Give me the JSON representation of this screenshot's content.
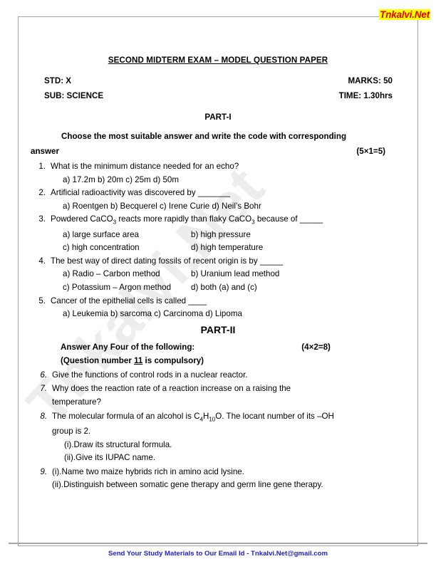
{
  "logo": {
    "text": "Tnkalvi.Net"
  },
  "watermark": {
    "text": "Tnkalvi.Net"
  },
  "header": {
    "title": "SECOND MIDTERM EXAM – MODEL QUESTION PAPER",
    "std_label": "STD: X",
    "marks_label": "MARKS: 50",
    "sub_label": "SUB:  SCIENCE",
    "time_label": "TIME: 1.30hrs"
  },
  "part1": {
    "heading": "PART-I",
    "instruction_line1": "Choose the most suitable answer and write the code with corresponding",
    "instruction_line2": "answer",
    "marks": "(5×1=5)",
    "questions": [
      {
        "number": "1.",
        "text": "What is the minimum distance needed for an echo?",
        "options_lines": [
          "a) 17.2m    b) 20m      c) 25m      d) 50m"
        ]
      },
      {
        "number": "2.",
        "text": "Artificial radioactivity was discovered by _______",
        "options_lines": [
          "a) Roentgen   b) Becquerel    c) Irene Curie    d) Neil’s Bohr"
        ]
      },
      {
        "number": "3.",
        "text_html": "Powdered CaCO<sub>3</sub> reacts more rapidly than flaky CaCO<sub>3</sub> because of _____",
        "options_2col": [
          {
            "left": "a) large surface area",
            "right": "b) high pressure"
          },
          {
            "left": "c) high concentration",
            "right": "d) high temperature"
          }
        ]
      },
      {
        "number": "4.",
        "text": "The best way of direct dating fossils of recent origin is by _____",
        "options_2col": [
          {
            "left": "a) Radio – Carbon method",
            "right": "b) Uranium lead method"
          },
          {
            "left": "c) Potassium – Argon method",
            "right": "d) both (a) and (c)"
          }
        ]
      },
      {
        "number": "5.",
        "text": "Cancer of  the epithelial cells is called ____",
        "options_lines": [
          "a) Leukemia   b) sarcoma  c) Carcinoma  d) Lipoma"
        ]
      }
    ]
  },
  "part2": {
    "heading": "PART-II",
    "instruction_line1": "Answer Any Four of the following:",
    "marks": "(4×2=8)",
    "instruction_line2_pre": "(Question number ",
    "instruction_line2_num": "11",
    "instruction_line2_post": " is compulsory)",
    "questions": [
      {
        "number": "6.",
        "text": "Give the functions of control rods in a nuclear reactor.",
        "extra_lines": []
      },
      {
        "number": "7.",
        "text": "Why does the reaction rate of a reaction increase on a raising the",
        "continuation": "temperature?",
        "extra_lines": []
      },
      {
        "number": "8.",
        "text_html": "The molecular formula of an alcohol is C<sub>4</sub>H<sub>10</sub>O. The locant number of its –OH",
        "continuation": "group is 2.",
        "extra_lines": [
          "(i).Draw its structural formula.",
          "(ii).Give its IUPAC name."
        ]
      },
      {
        "number": "9.",
        "text": "(i).Name two maize hybrids rich in amino acid lysine.",
        "extra_lines": [
          "(ii).Distinguish between somatic gene therapy and germ line gene therapy."
        ]
      }
    ]
  },
  "footer": {
    "text": "Send Your Study Materials to Our Email Id - Tnkalvi.Net@gmail.com"
  },
  "colors": {
    "logo_bg": "#ffff00",
    "logo_fg": "#e00000",
    "footer": "#2222cc",
    "frame": "#a6a6a6",
    "watermark": "#ededed"
  }
}
